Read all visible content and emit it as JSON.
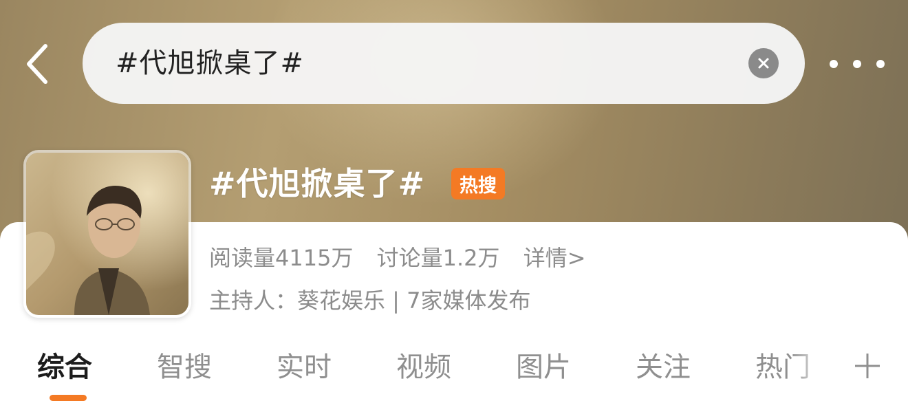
{
  "search": {
    "query": "#代旭掀桌了#"
  },
  "topic": {
    "title": "#代旭掀桌了#",
    "hot_badge": "热搜",
    "read_count": "阅读量4115万",
    "discussion_count": "讨论量1.2万",
    "details_link": "详情>",
    "host": "主持人：葵花娱乐 | 7家媒体发布"
  },
  "tabs": [
    {
      "label": "综合",
      "active": true
    },
    {
      "label": "智搜"
    },
    {
      "label": "实时"
    },
    {
      "label": "视频"
    },
    {
      "label": "图片"
    },
    {
      "label": "关注"
    },
    {
      "label": "热门"
    }
  ],
  "icons": {
    "back": "chevron-left-icon",
    "clear": "clear-icon",
    "more": "more-icon",
    "add_tab": "plus-icon"
  },
  "colors": {
    "accent": "#f47a24",
    "header_gradient": "#a48d62"
  }
}
